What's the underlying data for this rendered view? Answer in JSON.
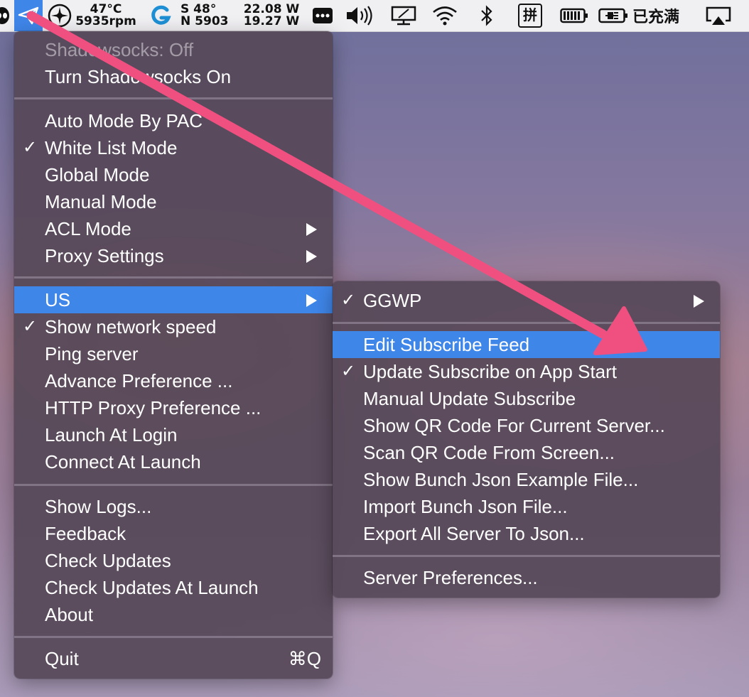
{
  "menubar": {
    "fan_temp": "47°C",
    "fan_rpm": "5935rpm",
    "net_up_label": "S",
    "net_up": "48°",
    "net_down_label": "N",
    "net_down": "5903",
    "power_in": "22.08 W",
    "power_out": "19.27 W",
    "input_method": "拼",
    "battery_status": "已充满",
    "active_color": "#3f86e9"
  },
  "main_menu": {
    "items": [
      {
        "label": "Shadowsocks: Off"
      },
      {
        "label": "Turn Shadowsocks On"
      },
      {
        "label": "Auto Mode By PAC"
      },
      {
        "label": "White List Mode",
        "check": "✓"
      },
      {
        "label": "Global Mode"
      },
      {
        "label": "Manual Mode"
      },
      {
        "label": "ACL Mode"
      },
      {
        "label": "Proxy Settings"
      },
      {
        "label": "US"
      },
      {
        "label": "Show network speed",
        "check": "✓"
      },
      {
        "label": "Ping server"
      },
      {
        "label": "Advance Preference ..."
      },
      {
        "label": "HTTP Proxy Preference ..."
      },
      {
        "label": "Launch At Login"
      },
      {
        "label": "Connect At Launch"
      },
      {
        "label": "Show Logs..."
      },
      {
        "label": "Feedback"
      },
      {
        "label": "Check Updates"
      },
      {
        "label": "Check Updates At Launch"
      },
      {
        "label": "About"
      },
      {
        "label": "Quit",
        "shortcut": "⌘Q"
      }
    ]
  },
  "sub_menu": {
    "items": [
      {
        "label": "GGWP",
        "check": "✓"
      },
      {
        "label": "Edit Subscribe Feed"
      },
      {
        "label": "Update Subscribe on App Start",
        "check": "✓"
      },
      {
        "label": "Manual Update Subscribe"
      },
      {
        "label": "Show QR Code For Current Server..."
      },
      {
        "label": "Scan QR Code From Screen..."
      },
      {
        "label": "Show Bunch Json Example File..."
      },
      {
        "label": "Import Bunch Json File..."
      },
      {
        "label": "Export All Server To Json..."
      },
      {
        "label": "Server Preferences..."
      }
    ]
  },
  "annotation": {
    "arrow_color": "#f0507f"
  }
}
